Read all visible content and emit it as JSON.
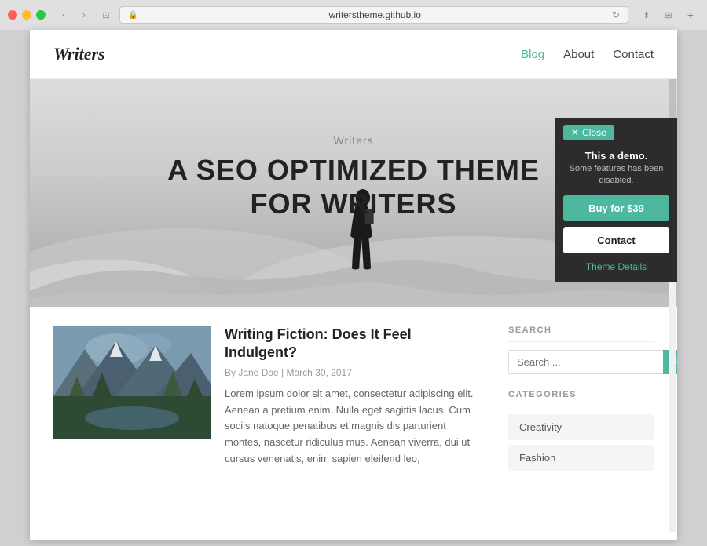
{
  "browser": {
    "url": "writerstheme.github.io",
    "url_display": "writerstheme.github.io"
  },
  "site": {
    "logo": "Writers",
    "nav": [
      {
        "label": "Blog",
        "active": true
      },
      {
        "label": "About",
        "active": false
      },
      {
        "label": "Contact",
        "active": false
      }
    ]
  },
  "hero": {
    "subtitle": "Writers",
    "title_line1": "A SEO OPTIMIZED THEME",
    "title_line2": "FOR WRITERS"
  },
  "demo_popup": {
    "close_label": "Close",
    "title": "This a demo.",
    "description": "Some features has been disabled.",
    "buy_label": "Buy for $39",
    "contact_label": "Contact",
    "theme_link_label": "Theme Details"
  },
  "post": {
    "title": "Writing Fiction: Does It Feel Indulgent?",
    "meta": "By Jane Doe | March 30, 2017",
    "excerpt": "Lorem ipsum dolor sit amet, consectetur adipiscing elit. Aenean a pretium enim. Nulla eget sagittis lacus. Cum sociis natoque penatibus et magnis dis parturient montes, nascetur ridiculus mus. Aenean viverra, dui ut cursus venenatis, enim sapien eleifend leo,"
  },
  "sidebar": {
    "search_label": "SEARCH",
    "search_placeholder": "Search ...",
    "categories_label": "CATEGORIES",
    "categories": [
      {
        "label": "Creativity"
      },
      {
        "label": "Fashion"
      }
    ]
  }
}
